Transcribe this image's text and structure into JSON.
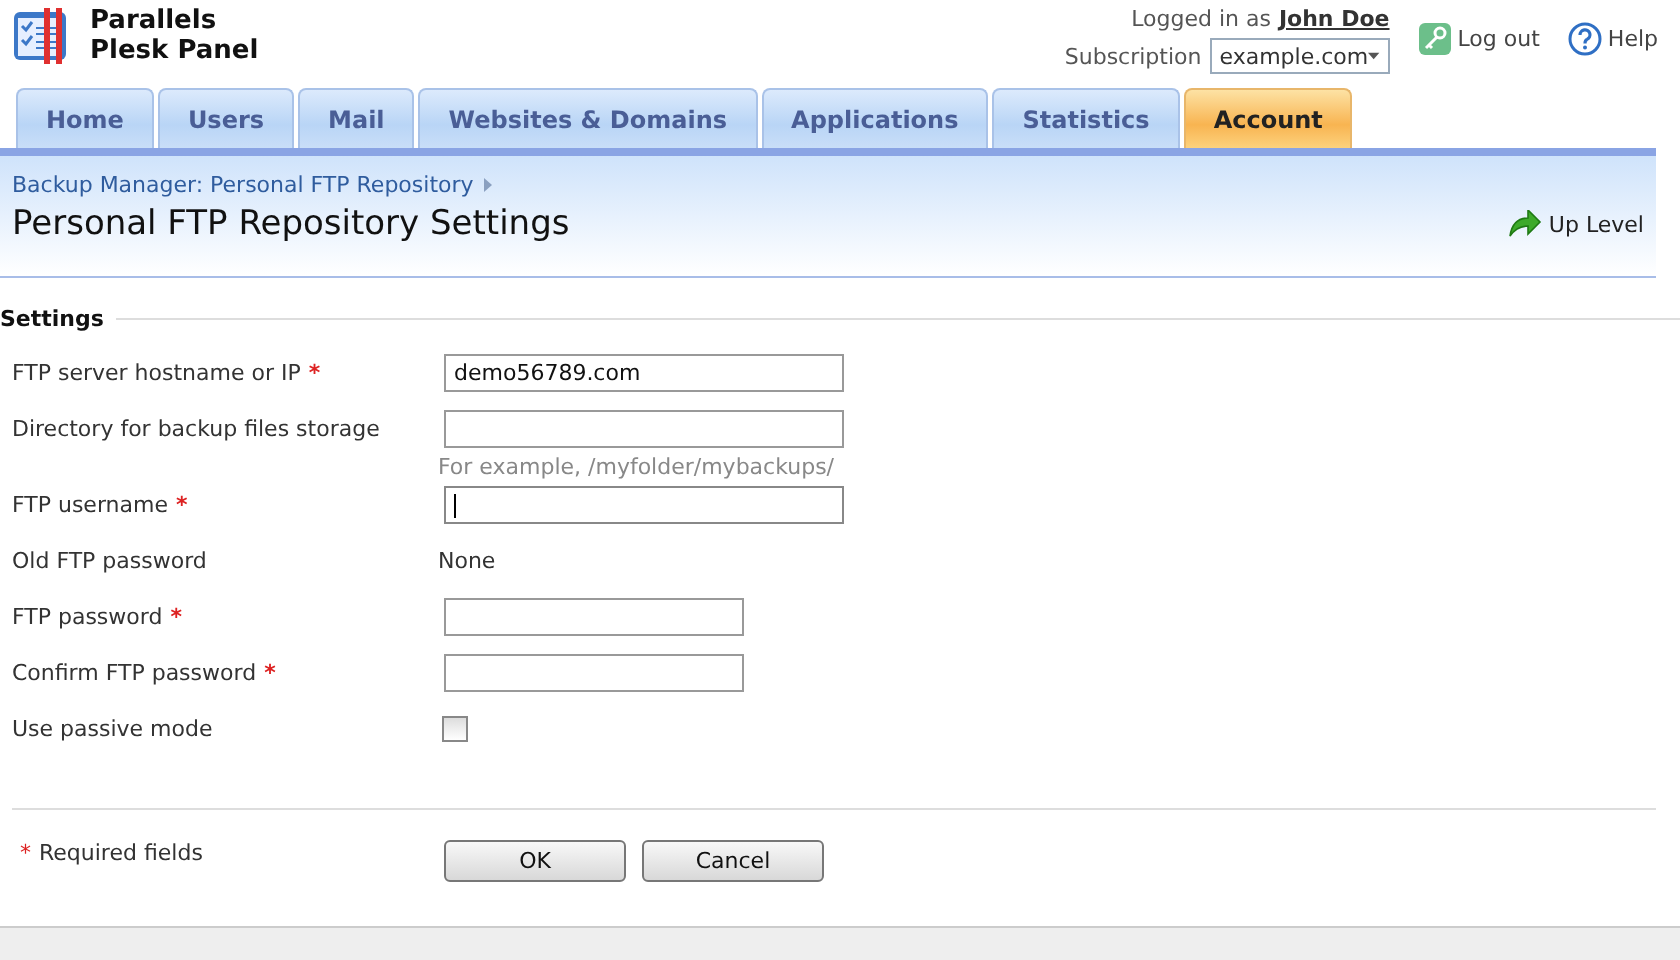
{
  "brand": {
    "line1": "Parallels",
    "line2": "Plesk Panel"
  },
  "user": {
    "prefix": "Logged in as",
    "name": "John Doe",
    "subscription_label": "Subscription",
    "subscription": "example.com"
  },
  "top_links": [
    {
      "label": "Log out",
      "kind": "logout"
    },
    {
      "label": "Help",
      "kind": "help"
    }
  ],
  "tabs": [
    {
      "label": "Home",
      "selected": false
    },
    {
      "label": "Users",
      "selected": false
    },
    {
      "label": "Mail",
      "selected": false
    },
    {
      "label": "Websites & Domains",
      "selected": false
    },
    {
      "label": "Applications",
      "selected": false
    },
    {
      "label": "Statistics",
      "selected": false
    },
    {
      "label": "Account",
      "selected": true
    }
  ],
  "breadcrumb": "Backup Manager: Personal FTP Repository",
  "page_title": "Personal FTP Repository Settings",
  "up_level": "Up Level",
  "section_title": "Settings",
  "fields": [
    {
      "kind": "text",
      "label": "FTP server hostname or IP",
      "required_mark": "*",
      "value": "demo56789.com",
      "focused": false
    },
    {
      "kind": "text",
      "label": "Directory for backup files storage",
      "focused": false,
      "hint": "For example, /myfolder/mybackups/"
    },
    {
      "kind": "text",
      "label": "FTP username",
      "required_mark": "*",
      "focused": true
    },
    {
      "kind": "static",
      "label": "Old FTP password",
      "value": "None"
    },
    {
      "kind": "password",
      "label": "FTP password",
      "required_mark": "*",
      "focused": false
    },
    {
      "kind": "password",
      "label": "Confirm FTP password",
      "required_mark": "*",
      "focused": false
    },
    {
      "kind": "checkbox",
      "label": "Use passive mode",
      "checked": false
    }
  ],
  "required_note": {
    "mark": "*",
    "text": "Required fields"
  },
  "buttons": [
    "OK",
    "Cancel"
  ]
}
